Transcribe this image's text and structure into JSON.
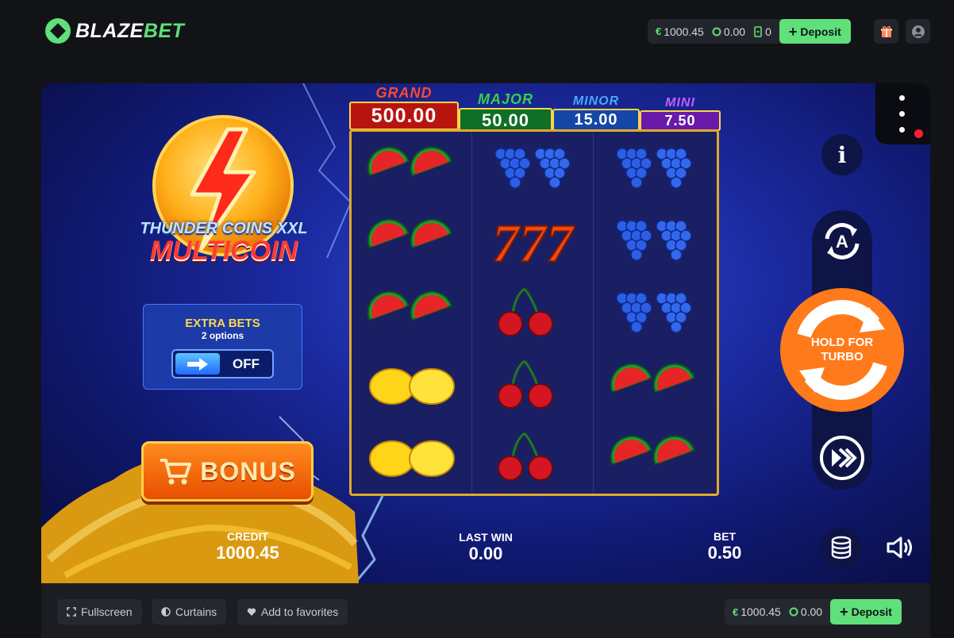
{
  "brand": {
    "name_part1": "BLAZE",
    "name_part2": "BET"
  },
  "header": {
    "balance_currency": "€",
    "balance": "1000.45",
    "bonus_balance": "0.00",
    "tickets": "0",
    "deposit_label": "Deposit"
  },
  "game": {
    "title_line1": "THUNDER COINS XXL",
    "title_line2": "MULTICOIN",
    "jackpots": [
      {
        "label": "GRAND",
        "value": "500.00",
        "color": "#e8231a"
      },
      {
        "label": "MAJOR",
        "value": "50.00",
        "color": "#1aa33a"
      },
      {
        "label": "MINOR",
        "value": "15.00",
        "color": "#1e6ce0"
      },
      {
        "label": "MINI",
        "value": "7.50",
        "color": "#8a2ad8"
      }
    ],
    "reels": [
      [
        "watermelon",
        "watermelon",
        "watermelon",
        "lemon",
        "lemon"
      ],
      [
        "grapes",
        "seven",
        "cherry",
        "cherry",
        "cherry"
      ],
      [
        "grapes",
        "grapes",
        "grapes",
        "watermelon",
        "watermelon"
      ]
    ],
    "extra_bets": {
      "title": "EXTRA BETS",
      "subtitle": "2 options",
      "state": "OFF"
    },
    "bonus_label": "BONUS",
    "turbo_label_1": "HOLD FOR",
    "turbo_label_2": "TURBO",
    "auto_label": "A",
    "info_label": "i",
    "credit_label": "CREDIT",
    "credit_value": "1000.45",
    "last_win_label": "LAST WIN",
    "last_win_value": "0.00",
    "bet_label": "BET",
    "bet_value": "0.50"
  },
  "footer": {
    "fullscreen_label": "Fullscreen",
    "curtains_label": "Curtains",
    "favorites_label": "Add to favorites",
    "balance_currency": "€",
    "balance": "1000.45",
    "bonus_balance": "0.00",
    "deposit_label": "Deposit"
  },
  "colors": {
    "accent": "#5fe07a",
    "turbo": "#ff7a1a",
    "frame": "#e2a92a"
  }
}
